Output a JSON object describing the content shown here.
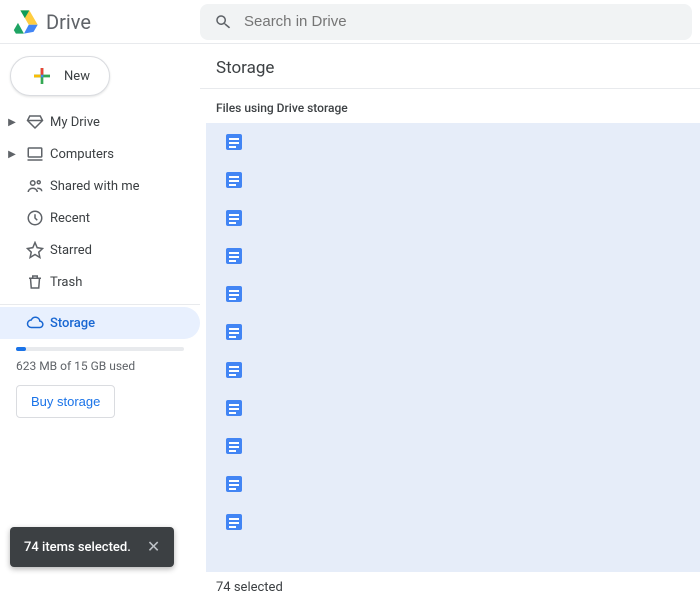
{
  "app_name": "Drive",
  "search": {
    "placeholder": "Search in Drive"
  },
  "new_button_label": "New",
  "sidebar": {
    "items": [
      {
        "label": "My Drive",
        "expandable": true
      },
      {
        "label": "Computers",
        "expandable": true
      },
      {
        "label": "Shared with me",
        "expandable": false
      },
      {
        "label": "Recent",
        "expandable": false
      },
      {
        "label": "Starred",
        "expandable": false
      },
      {
        "label": "Trash",
        "expandable": false
      }
    ],
    "storage_label": "Storage",
    "usage_text": "623 MB of 15 GB used",
    "buy_label": "Buy storage"
  },
  "main": {
    "title": "Storage",
    "subheader": "Files using Drive storage",
    "file_count_visible": 11,
    "footer_status": "74 selected"
  },
  "toast": {
    "message": "74 items selected."
  },
  "colors": {
    "accent": "#1a73e8",
    "selection_bg": "#e6edf9"
  }
}
